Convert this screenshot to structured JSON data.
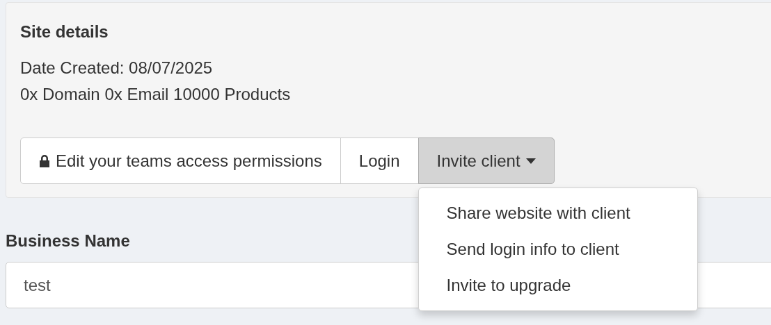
{
  "site_details": {
    "title": "Site details",
    "date_created": "Date Created: 08/07/2025",
    "stats": "0x Domain 0x Email 10000 Products",
    "buttons": [
      {
        "label": "Edit your teams access permissions",
        "kind": "lock",
        "active": false
      },
      {
        "label": "Login",
        "kind": "plain",
        "active": false
      },
      {
        "label": "Invite client",
        "kind": "dropdown",
        "active": true
      }
    ],
    "dropdown_menu": {
      "open": true,
      "items": [
        {
          "label": "Share website with client"
        },
        {
          "label": "Send login info to client"
        },
        {
          "label": "Invite to upgrade"
        }
      ]
    }
  },
  "business_name": {
    "label": "Business Name",
    "value": "test"
  }
}
